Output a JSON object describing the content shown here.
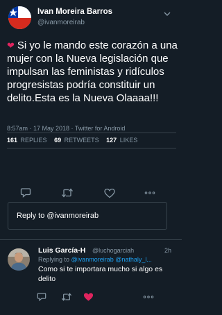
{
  "tweet": {
    "author_name": "Ivan Moreira Barros",
    "author_handle": "@ivanmoreirab",
    "text": "Si yo le mando este corazón a una mujer con la Nueva legislación que impulsan las feministas y ridículos progresistas podría constituir un delito.Esta es la Nueva Olaaaa!!!",
    "meta": "8:57am · 17 May 2018 · Twitter for Android",
    "replies_count": "161",
    "replies_label": "REPLIES",
    "retweets_count": "69",
    "retweets_label": "RETWEETS",
    "likes_count": "127",
    "likes_label": "LIKES"
  },
  "reply_box": {
    "placeholder": "Reply to @ivanmoreirab"
  },
  "reply": {
    "author_name": "Luis García-H",
    "author_handle": "@luchogarciah",
    "time": "2h",
    "replying_prefix": "Replying to",
    "mention_1": "@ivanmoreirab",
    "mention_2": "@nathaly_l...",
    "text": "Como si te importara mucho si algo es delito"
  },
  "icons": [
    "chevron-down-icon",
    "reply-icon",
    "retweet-icon",
    "heart-icon",
    "more-icon"
  ],
  "colors": {
    "background": "#141d26",
    "secondary_text": "#8899a6",
    "divider": "#38444d",
    "link": "#1da1f2",
    "like": "#e0245e"
  }
}
